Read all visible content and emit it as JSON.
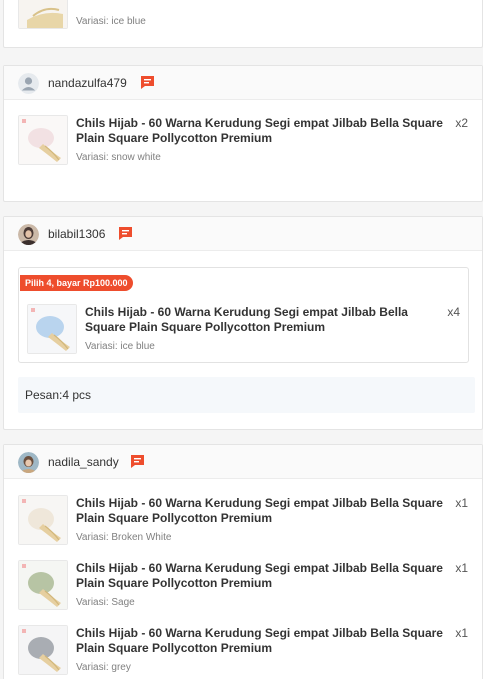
{
  "orders": [
    {
      "items": [
        {
          "variant": "Variasi: ice blue"
        }
      ]
    },
    {
      "username": "nandazulfa479",
      "items": [
        {
          "title": "Chils Hijab - 60 Warna Kerudung Segi empat Jilbab Bella Square Plain Square Pollycotton Premium",
          "qty": "x2",
          "variant": "Variasi: snow white"
        }
      ]
    },
    {
      "username": "bilabil1306",
      "promo_badge": "Pilih 4, bayar Rp100.000",
      "items": [
        {
          "title": "Chils Hijab - 60 Warna Kerudung Segi empat Jilbab Bella Square Plain Square Pollycotton Premium",
          "qty": "x4",
          "variant": "Variasi: ice blue"
        }
      ],
      "note": "Pesan:4 pcs"
    },
    {
      "username": "nadila_sandy",
      "items": [
        {
          "title": "Chils Hijab - 60 Warna Kerudung Segi empat Jilbab Bella Square Plain Square Pollycotton Premium",
          "qty": "x1",
          "variant": "Variasi: Broken White"
        },
        {
          "title": "Chils Hijab - 60 Warna Kerudung Segi empat Jilbab Bella Square Plain Square Pollycotton Premium",
          "qty": "x1",
          "variant": "Variasi: Sage"
        },
        {
          "title": "Chils Hijab - 60 Warna Kerudung Segi empat Jilbab Bella Square Plain Square Pollycotton Premium",
          "qty": "x1",
          "variant": "Variasi: grey"
        }
      ]
    }
  ],
  "colors": {
    "accent": "#ee4d2d",
    "note_bg": "#f5f8fb"
  },
  "icons": {
    "chat": "chat-icon",
    "avatar": "avatar"
  }
}
